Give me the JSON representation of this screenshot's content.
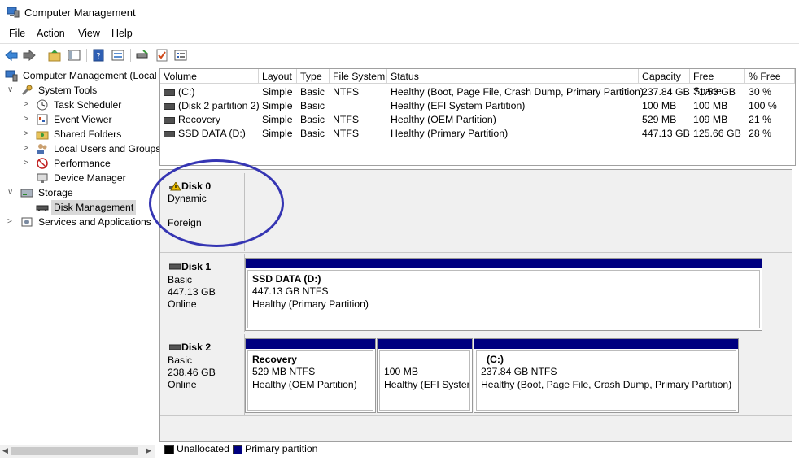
{
  "window": {
    "title": "Computer Management"
  },
  "menu": [
    "File",
    "Action",
    "View",
    "Help"
  ],
  "tree": {
    "root": "Computer Management (Local",
    "items": [
      {
        "label": "System Tools",
        "level": 1,
        "icon": "tools-icon",
        "expander": "∨"
      },
      {
        "label": "Task Scheduler",
        "level": 2,
        "icon": "clock-icon",
        "expander": ">"
      },
      {
        "label": "Event Viewer",
        "level": 2,
        "icon": "event-viewer-icon",
        "expander": ">"
      },
      {
        "label": "Shared Folders",
        "level": 2,
        "icon": "shared-folder-icon",
        "expander": ">"
      },
      {
        "label": "Local Users and Groups",
        "level": 2,
        "icon": "users-icon",
        "expander": ">"
      },
      {
        "label": "Performance",
        "level": 2,
        "icon": "performance-icon",
        "expander": ">"
      },
      {
        "label": "Device Manager",
        "level": 2,
        "icon": "device-manager-icon",
        "expander": ""
      },
      {
        "label": "Storage",
        "level": 1,
        "icon": "storage-icon",
        "expander": "∨"
      },
      {
        "label": "Disk Management",
        "level": 2,
        "icon": "disk-icon",
        "expander": "",
        "selected": true
      },
      {
        "label": "Services and Applications",
        "level": 1,
        "icon": "services-icon",
        "expander": ">"
      }
    ]
  },
  "volumes": {
    "columns": [
      "Volume",
      "Layout",
      "Type",
      "File System",
      "Status",
      "Capacity",
      "Free Space",
      "% Free"
    ],
    "rows": [
      [
        "(C:)",
        "Simple",
        "Basic",
        "NTFS",
        "Healthy (Boot, Page File, Crash Dump, Primary Partition)",
        "237.84 GB",
        "71.53 GB",
        "30 %"
      ],
      [
        "(Disk 2 partition 2)",
        "Simple",
        "Basic",
        "",
        "Healthy (EFI System Partition)",
        "100 MB",
        "100 MB",
        "100 %"
      ],
      [
        "Recovery",
        "Simple",
        "Basic",
        "NTFS",
        "Healthy (OEM Partition)",
        "529 MB",
        "109 MB",
        "21 %"
      ],
      [
        "SSD DATA (D:)",
        "Simple",
        "Basic",
        "NTFS",
        "Healthy (Primary Partition)",
        "447.13 GB",
        "125.66 GB",
        "28 %"
      ]
    ]
  },
  "disks": [
    {
      "name": "Disk 0",
      "type": "Dynamic",
      "size": "",
      "state": "Foreign",
      "warning": true,
      "partitions": []
    },
    {
      "name": "Disk 1",
      "type": "Basic",
      "size": "447.13 GB",
      "state": "Online",
      "partitions": [
        {
          "title": "SSD DATA  (D:)",
          "size": "447.13 GB NTFS",
          "status": "Healthy (Primary Partition)"
        }
      ]
    },
    {
      "name": "Disk 2",
      "type": "Basic",
      "size": "238.46 GB",
      "state": "Online",
      "partitions": [
        {
          "title": "Recovery",
          "size": "529 MB NTFS",
          "status": "Healthy (OEM Partition)"
        },
        {
          "title": "",
          "size": "100 MB",
          "status": "Healthy (EFI System"
        },
        {
          "title": "(C:)",
          "size": "237.84 GB NTFS",
          "status": "Healthy (Boot, Page File, Crash Dump, Primary Partition)"
        }
      ]
    }
  ],
  "legend": [
    {
      "label": "Unallocated",
      "color": "#000000"
    },
    {
      "label": "Primary partition",
      "color": "#000080"
    }
  ],
  "colors": {
    "primary_partition": "#000080",
    "selection": "#d9d9d9",
    "annotation_circle": "#3535b3"
  }
}
